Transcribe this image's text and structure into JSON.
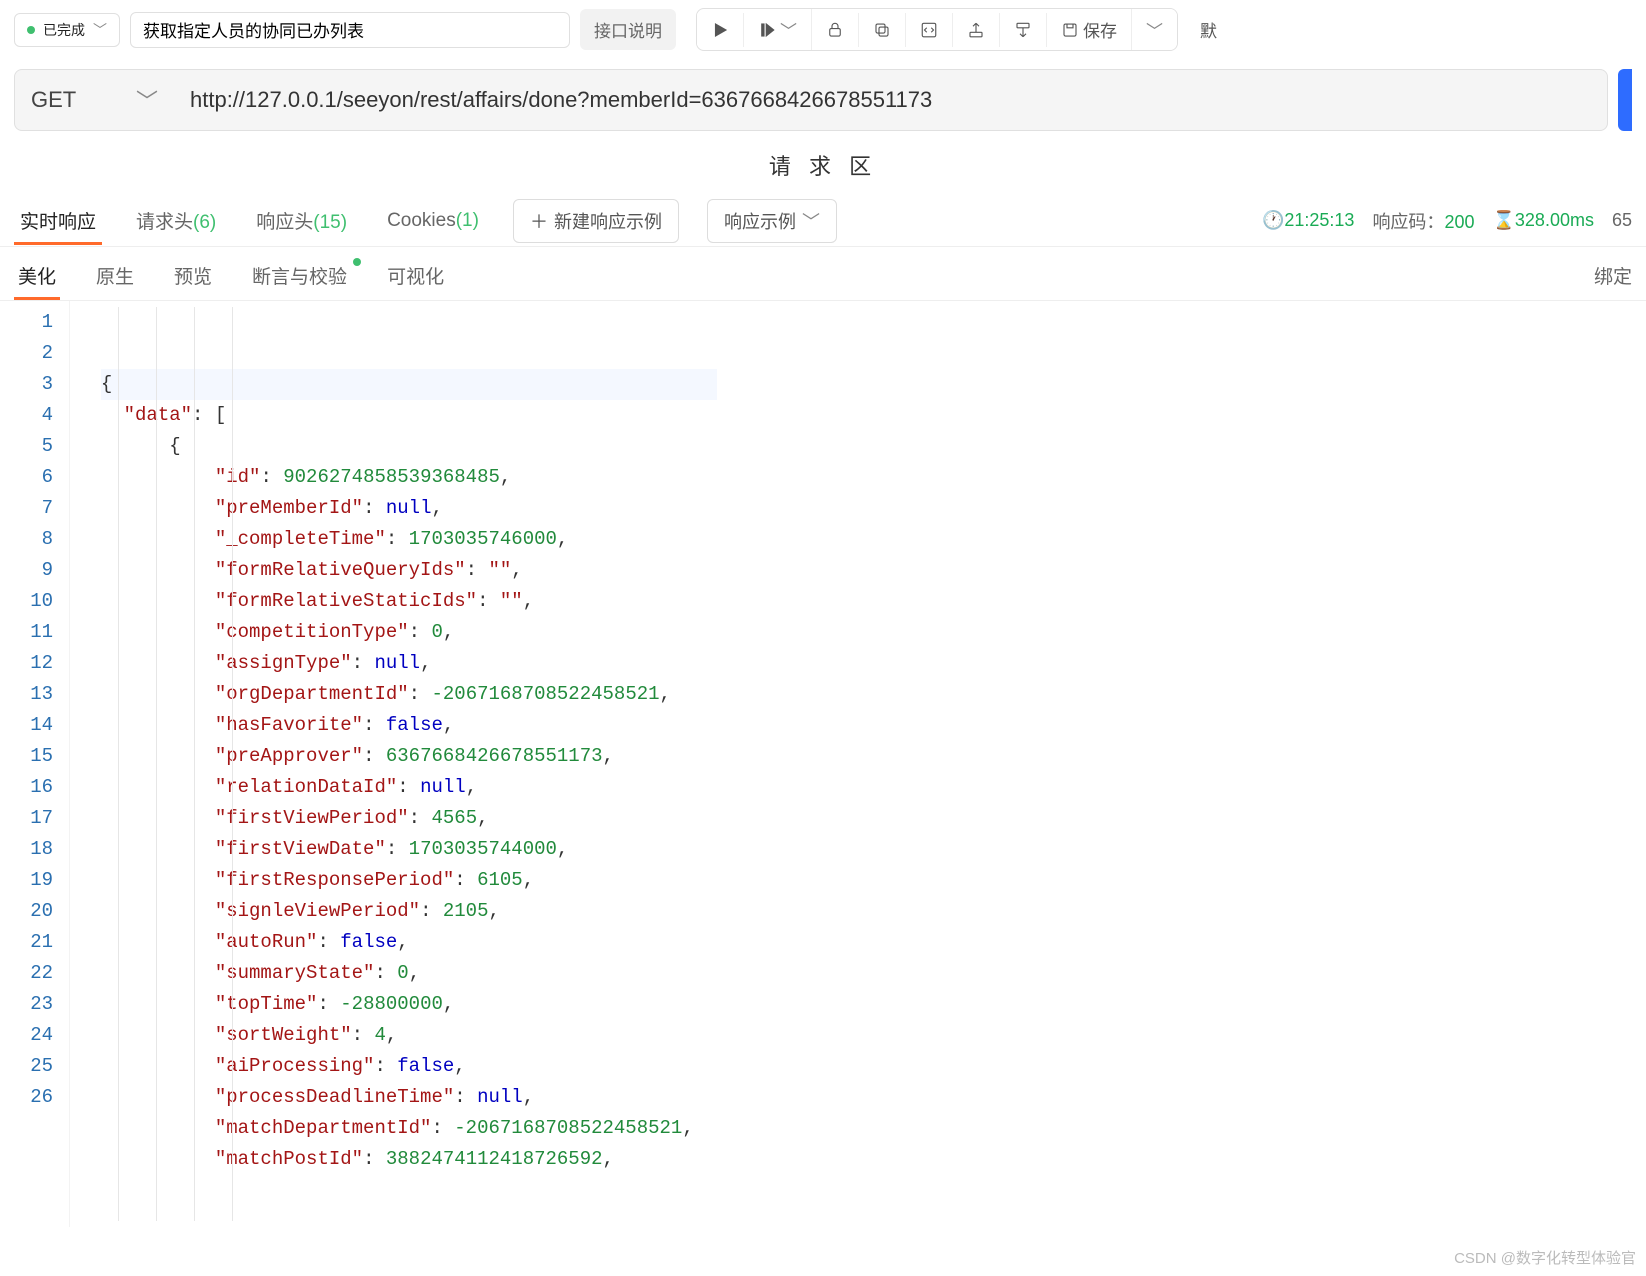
{
  "toolbar": {
    "status": "已完成",
    "api_title": "获取指定人员的协同已办列表",
    "spec_btn": "接口说明",
    "save_label": "保存",
    "default_label": "默"
  },
  "request": {
    "method": "GET",
    "url": "http://127.0.0.1/seeyon/rest/affairs/done?memberId=6367668426678551173",
    "section_title": "请 求 区"
  },
  "tabs": {
    "realtime": "实时响应",
    "req_header": "请求头",
    "req_header_count": "(6)",
    "resp_header": "响应头",
    "resp_header_count": "(15)",
    "cookies": "Cookies",
    "cookies_count": "(1)",
    "new_example": "新建响应示例",
    "example": "响应示例"
  },
  "meta": {
    "time_clock": "21:25:13",
    "status_label": "响应码：",
    "status_code": "200",
    "duration": "328.00ms",
    "size": "65"
  },
  "subtabs": {
    "beautify": "美化",
    "raw": "原生",
    "preview": "预览",
    "assert": "断言与校验",
    "visualize": "可视化",
    "bind": "绑定"
  },
  "code_lines": [
    [
      [
        "p",
        "{"
      ]
    ],
    [
      [
        "p",
        "    "
      ],
      [
        "k",
        "\"data\""
      ],
      [
        "p",
        ": ["
      ]
    ],
    [
      [
        "p",
        "        {"
      ]
    ],
    [
      [
        "p",
        "            "
      ],
      [
        "k",
        "\"id\""
      ],
      [
        "p",
        ": "
      ],
      [
        "n",
        "9026274858539368485"
      ],
      [
        "p",
        ","
      ]
    ],
    [
      [
        "p",
        "            "
      ],
      [
        "k",
        "\"preMemberId\""
      ],
      [
        "p",
        ": "
      ],
      [
        "nl",
        "null"
      ],
      [
        "p",
        ","
      ]
    ],
    [
      [
        "p",
        "            "
      ],
      [
        "k",
        "\"_completeTime\""
      ],
      [
        "p",
        ": "
      ],
      [
        "n",
        "1703035746000"
      ],
      [
        "p",
        ","
      ]
    ],
    [
      [
        "p",
        "            "
      ],
      [
        "k",
        "\"formRelativeQueryIds\""
      ],
      [
        "p",
        ": "
      ],
      [
        "k",
        "\"\""
      ],
      [
        "p",
        ","
      ]
    ],
    [
      [
        "p",
        "            "
      ],
      [
        "k",
        "\"formRelativeStaticIds\""
      ],
      [
        "p",
        ": "
      ],
      [
        "k",
        "\"\""
      ],
      [
        "p",
        ","
      ]
    ],
    [
      [
        "p",
        "            "
      ],
      [
        "k",
        "\"competitionType\""
      ],
      [
        "p",
        ": "
      ],
      [
        "n",
        "0"
      ],
      [
        "p",
        ","
      ]
    ],
    [
      [
        "p",
        "            "
      ],
      [
        "k",
        "\"assignType\""
      ],
      [
        "p",
        ": "
      ],
      [
        "nl",
        "null"
      ],
      [
        "p",
        ","
      ]
    ],
    [
      [
        "p",
        "            "
      ],
      [
        "k",
        "\"orgDepartmentId\""
      ],
      [
        "p",
        ": "
      ],
      [
        "n",
        "-2067168708522458521"
      ],
      [
        "p",
        ","
      ]
    ],
    [
      [
        "p",
        "            "
      ],
      [
        "k",
        "\"hasFavorite\""
      ],
      [
        "p",
        ": "
      ],
      [
        "b",
        "false"
      ],
      [
        "p",
        ","
      ]
    ],
    [
      [
        "p",
        "            "
      ],
      [
        "k",
        "\"preApprover\""
      ],
      [
        "p",
        ": "
      ],
      [
        "n",
        "6367668426678551173"
      ],
      [
        "p",
        ","
      ]
    ],
    [
      [
        "p",
        "            "
      ],
      [
        "k",
        "\"relationDataId\""
      ],
      [
        "p",
        ": "
      ],
      [
        "nl",
        "null"
      ],
      [
        "p",
        ","
      ]
    ],
    [
      [
        "p",
        "            "
      ],
      [
        "k",
        "\"firstViewPeriod\""
      ],
      [
        "p",
        ": "
      ],
      [
        "n",
        "4565"
      ],
      [
        "p",
        ","
      ]
    ],
    [
      [
        "p",
        "            "
      ],
      [
        "k",
        "\"firstViewDate\""
      ],
      [
        "p",
        ": "
      ],
      [
        "n",
        "1703035744000"
      ],
      [
        "p",
        ","
      ]
    ],
    [
      [
        "p",
        "            "
      ],
      [
        "k",
        "\"firstResponsePeriod\""
      ],
      [
        "p",
        ": "
      ],
      [
        "n",
        "6105"
      ],
      [
        "p",
        ","
      ]
    ],
    [
      [
        "p",
        "            "
      ],
      [
        "k",
        "\"signleViewPeriod\""
      ],
      [
        "p",
        ": "
      ],
      [
        "n",
        "2105"
      ],
      [
        "p",
        ","
      ]
    ],
    [
      [
        "p",
        "            "
      ],
      [
        "k",
        "\"autoRun\""
      ],
      [
        "p",
        ": "
      ],
      [
        "b",
        "false"
      ],
      [
        "p",
        ","
      ]
    ],
    [
      [
        "p",
        "            "
      ],
      [
        "k",
        "\"summaryState\""
      ],
      [
        "p",
        ": "
      ],
      [
        "n",
        "0"
      ],
      [
        "p",
        ","
      ]
    ],
    [
      [
        "p",
        "            "
      ],
      [
        "k",
        "\"topTime\""
      ],
      [
        "p",
        ": "
      ],
      [
        "n",
        "-28800000"
      ],
      [
        "p",
        ","
      ]
    ],
    [
      [
        "p",
        "            "
      ],
      [
        "k",
        "\"sortWeight\""
      ],
      [
        "p",
        ": "
      ],
      [
        "n",
        "4"
      ],
      [
        "p",
        ","
      ]
    ],
    [
      [
        "p",
        "            "
      ],
      [
        "k",
        "\"aiProcessing\""
      ],
      [
        "p",
        ": "
      ],
      [
        "b",
        "false"
      ],
      [
        "p",
        ","
      ]
    ],
    [
      [
        "p",
        "            "
      ],
      [
        "k",
        "\"processDeadlineTime\""
      ],
      [
        "p",
        ": "
      ],
      [
        "nl",
        "null"
      ],
      [
        "p",
        ","
      ]
    ],
    [
      [
        "p",
        "            "
      ],
      [
        "k",
        "\"matchDepartmentId\""
      ],
      [
        "p",
        ": "
      ],
      [
        "n",
        "-2067168708522458521"
      ],
      [
        "p",
        ","
      ]
    ],
    [
      [
        "p",
        "            "
      ],
      [
        "k",
        "\"matchPostId\""
      ],
      [
        "p",
        ": "
      ],
      [
        "n",
        "3882474112418726592"
      ],
      [
        "p",
        ","
      ]
    ]
  ],
  "watermark": "CSDN @数字化转型体验官"
}
